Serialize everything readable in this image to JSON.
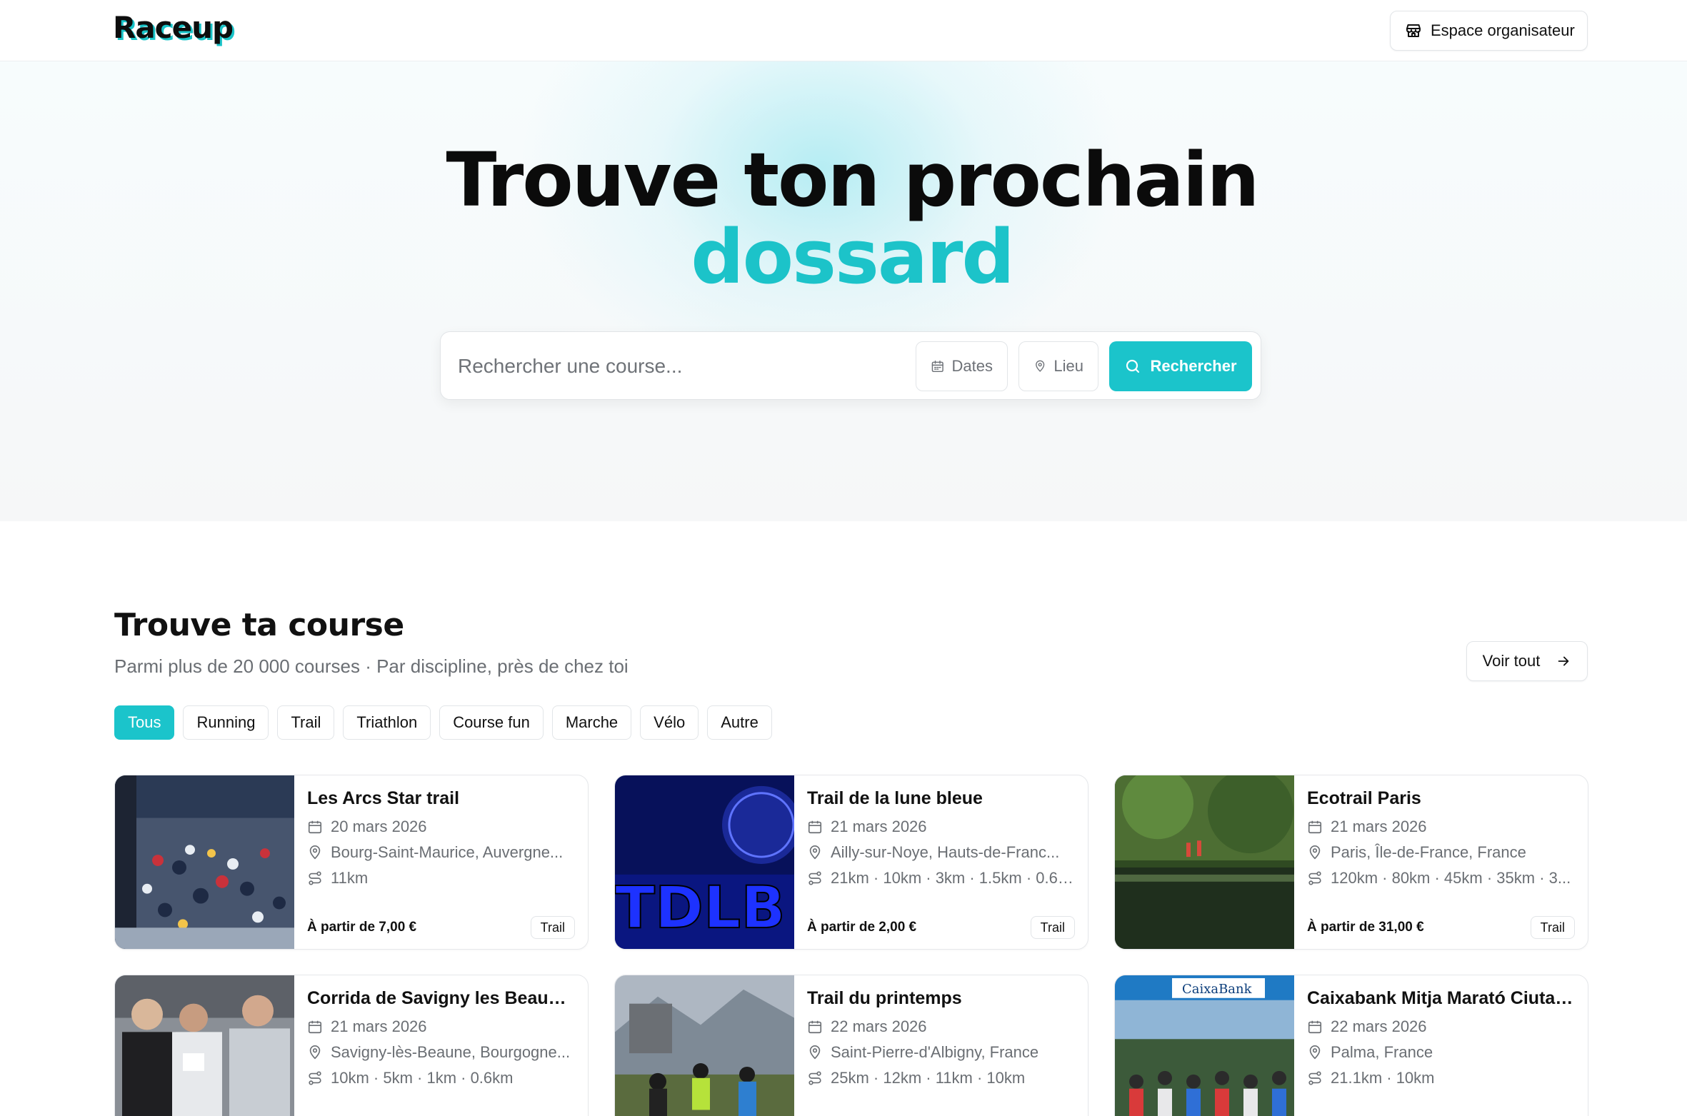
{
  "header": {
    "logo": "Raceup",
    "organizer_button": "Espace organisateur"
  },
  "hero": {
    "title": "Trouve ton prochain",
    "title_accent": "dossard",
    "search_placeholder": "Rechercher une course...",
    "dates_label": "Dates",
    "location_label": "Lieu",
    "search_button": "Rechercher"
  },
  "section": {
    "title": "Trouve ta course",
    "subtitle": "Parmi plus de 20 000 courses · Par discipline, près de chez toi",
    "see_all": "Voir tout",
    "filters": [
      "Tous",
      "Running",
      "Trail",
      "Triathlon",
      "Course fun",
      "Marche",
      "Vélo",
      "Autre"
    ],
    "active_filter": "Tous"
  },
  "races": [
    {
      "title": "Les Arcs Star trail",
      "date": "20 mars 2026",
      "location": "Bourg-Saint-Maurice, Auvergne...",
      "distances": "11km",
      "price": "À partir de 7,00 €",
      "tag": "Trail"
    },
    {
      "title": "Trail de la lune bleue",
      "date": "21 mars 2026",
      "location": "Ailly-sur-Noye, Hauts-de-Franc...",
      "distances": "21km · 10km · 3km · 1.5km · 0.6k...",
      "price": "À partir de 2,00 €",
      "tag": "Trail"
    },
    {
      "title": "Ecotrail Paris",
      "date": "21 mars 2026",
      "location": "Paris, Île-de-France, France",
      "distances": "120km · 80km · 45km · 35km · 3...",
      "price": "À partir de 31,00 €",
      "tag": "Trail"
    },
    {
      "title": "Corrida de Savigny les Beaune...",
      "date": "21 mars 2026",
      "location": "Savigny-lès-Beaune, Bourgogne...",
      "distances": "10km · 5km · 1km · 0.6km",
      "price": "",
      "tag": ""
    },
    {
      "title": "Trail du printemps",
      "date": "22 mars 2026",
      "location": "Saint-Pierre-d'Albigny, France",
      "distances": "25km · 12km · 11km · 10km",
      "price": "",
      "tag": ""
    },
    {
      "title": "Caixabank Mitja Marató Ciutat...",
      "date": "22 mars 2026",
      "location": "Palma, France",
      "distances": "21.1km · 10km",
      "price": "",
      "tag": ""
    }
  ],
  "image_texts": {
    "tdlb": "TDLB",
    "caixabank": "CaixaBank"
  },
  "colors": {
    "accent": "#1bc4cb",
    "text": "#111111",
    "muted": "#6a6e73"
  }
}
